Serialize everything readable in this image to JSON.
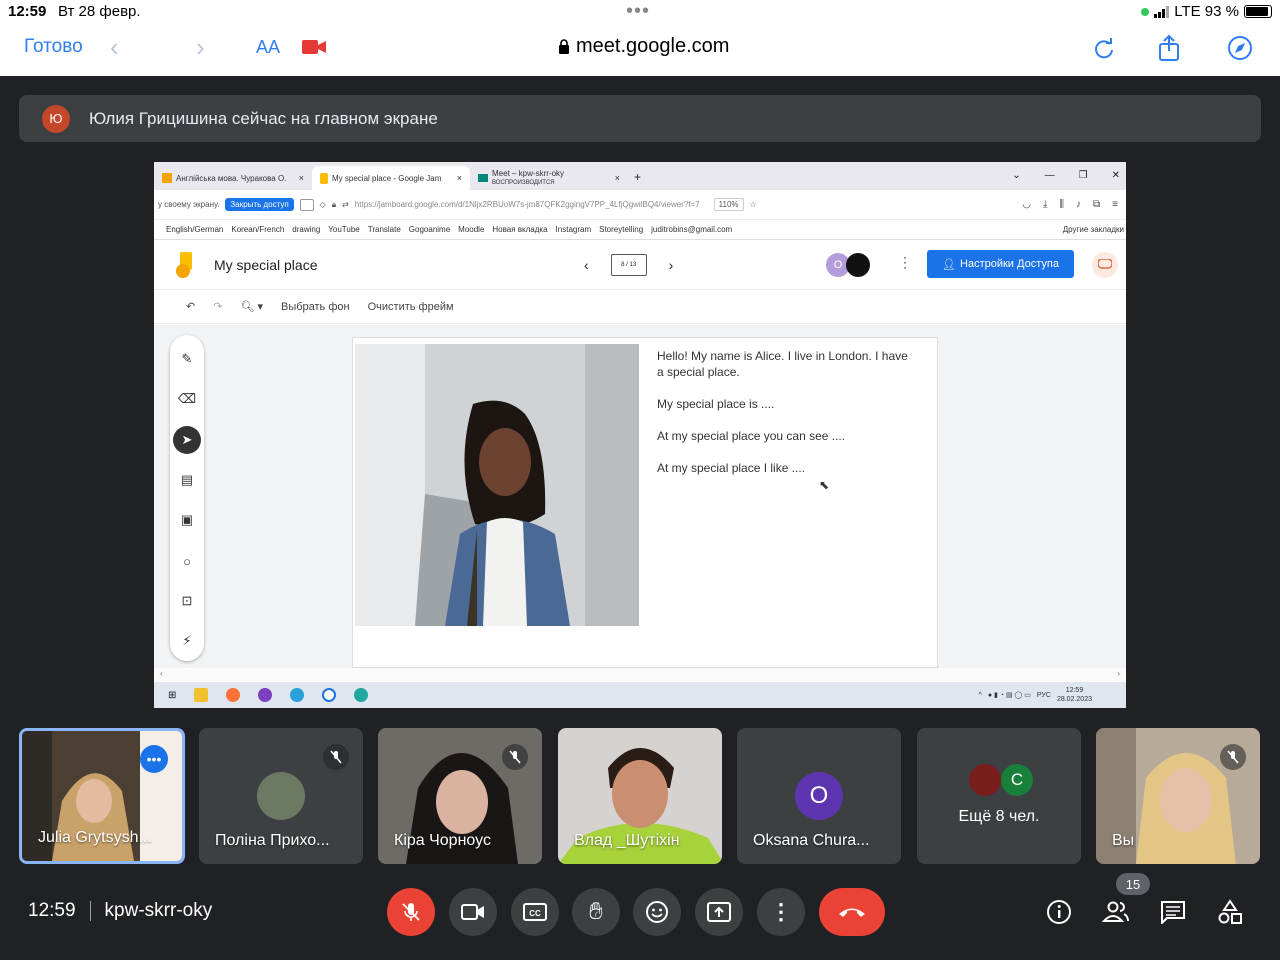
{
  "status": {
    "time": "12:59",
    "date": "Вт 28 февр.",
    "network": "LTE 93 %"
  },
  "safari": {
    "done_label": "Готово",
    "text_size_label": "AA",
    "url": "meet.google.com"
  },
  "banner": {
    "avatar_letter": "Ю",
    "text": "Юлия Грицишина сейчас на главном экране"
  },
  "presentation": {
    "tabs": [
      {
        "title": "Англійська мова. Чуракова О.",
        "close": "×"
      },
      {
        "title": "My special place - Google Jam",
        "close": "×"
      },
      {
        "title": "Meet – kpw-skrr-oky",
        "sub": "ВОСПРОИЗВОДИТСЯ",
        "close": "×"
      }
    ],
    "new_tab": "+",
    "share_prompt": "у своему экрану.",
    "stop_sharing": "Закрыть доступ",
    "address_url": "https://jamboard.google.com/d/1Nljx2RBUoW7s-jm87QFK2ggingV7PP_4LfjQgwilBQ4/viewer?f=7",
    "zoom": "110%",
    "bookmarks": [
      "English/German",
      "Korean/French",
      "drawing",
      "YouTube",
      "Translate",
      "Gogoanime",
      "Moodle",
      "Новая вкладка",
      "Instagram",
      "Storeytelling",
      "juditrobins@gmail.com"
    ],
    "other_bookmarks": "Другие закладки",
    "jam_title": "My special place",
    "frame_counter": "8 / 13",
    "avatar_o": "O",
    "share_button": "Настройки Доступа",
    "set_background": "Выбрать фон",
    "clear_frame": "Очистить фрейм",
    "notes": [
      "Hello! My name is Alice. I live in London. I have a special place.",
      "My special place is ....",
      "At my special place you can see ....",
      "At my special place I like ...."
    ],
    "taskbar_lang": "РУС",
    "taskbar_time": "12:59",
    "taskbar_date": "28.02.2023"
  },
  "tiles": [
    {
      "name": "Julia Grytsysh...",
      "avatar": ""
    },
    {
      "name": "Поліна Прихо...",
      "avatar": ""
    },
    {
      "name": "Кіра Чорноус",
      "avatar": ""
    },
    {
      "name": "Влад _Шутіхін",
      "avatar": ""
    },
    {
      "name": "Oksana Chura...",
      "avatar": "O"
    },
    {
      "name": "Ещё 8 чел.",
      "avatar": "C"
    },
    {
      "name": "Вы",
      "avatar": ""
    }
  ],
  "footer": {
    "time": "12:59",
    "meeting_code": "kpw-skrr-oky",
    "participant_count": "15"
  },
  "colors": {
    "meet_bg": "#202124",
    "tile_bg": "#3c4043",
    "red": "#ea4335",
    "blue": "#1a73e8"
  }
}
